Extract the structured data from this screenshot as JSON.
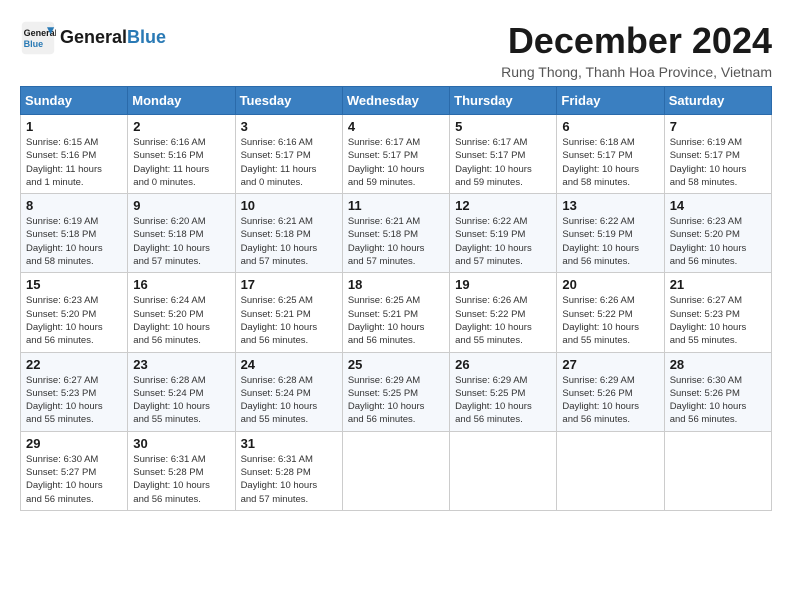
{
  "logo": {
    "line1": "General",
    "line2": "Blue"
  },
  "title": "December 2024",
  "location": "Rung Thong, Thanh Hoa Province, Vietnam",
  "weekdays": [
    "Sunday",
    "Monday",
    "Tuesday",
    "Wednesday",
    "Thursday",
    "Friday",
    "Saturday"
  ],
  "weeks": [
    [
      {
        "day": "1",
        "info": "Sunrise: 6:15 AM\nSunset: 5:16 PM\nDaylight: 11 hours\nand 1 minute."
      },
      {
        "day": "2",
        "info": "Sunrise: 6:16 AM\nSunset: 5:16 PM\nDaylight: 11 hours\nand 0 minutes."
      },
      {
        "day": "3",
        "info": "Sunrise: 6:16 AM\nSunset: 5:17 PM\nDaylight: 11 hours\nand 0 minutes."
      },
      {
        "day": "4",
        "info": "Sunrise: 6:17 AM\nSunset: 5:17 PM\nDaylight: 10 hours\nand 59 minutes."
      },
      {
        "day": "5",
        "info": "Sunrise: 6:17 AM\nSunset: 5:17 PM\nDaylight: 10 hours\nand 59 minutes."
      },
      {
        "day": "6",
        "info": "Sunrise: 6:18 AM\nSunset: 5:17 PM\nDaylight: 10 hours\nand 58 minutes."
      },
      {
        "day": "7",
        "info": "Sunrise: 6:19 AM\nSunset: 5:17 PM\nDaylight: 10 hours\nand 58 minutes."
      }
    ],
    [
      {
        "day": "8",
        "info": "Sunrise: 6:19 AM\nSunset: 5:18 PM\nDaylight: 10 hours\nand 58 minutes."
      },
      {
        "day": "9",
        "info": "Sunrise: 6:20 AM\nSunset: 5:18 PM\nDaylight: 10 hours\nand 57 minutes."
      },
      {
        "day": "10",
        "info": "Sunrise: 6:21 AM\nSunset: 5:18 PM\nDaylight: 10 hours\nand 57 minutes."
      },
      {
        "day": "11",
        "info": "Sunrise: 6:21 AM\nSunset: 5:18 PM\nDaylight: 10 hours\nand 57 minutes."
      },
      {
        "day": "12",
        "info": "Sunrise: 6:22 AM\nSunset: 5:19 PM\nDaylight: 10 hours\nand 57 minutes."
      },
      {
        "day": "13",
        "info": "Sunrise: 6:22 AM\nSunset: 5:19 PM\nDaylight: 10 hours\nand 56 minutes."
      },
      {
        "day": "14",
        "info": "Sunrise: 6:23 AM\nSunset: 5:20 PM\nDaylight: 10 hours\nand 56 minutes."
      }
    ],
    [
      {
        "day": "15",
        "info": "Sunrise: 6:23 AM\nSunset: 5:20 PM\nDaylight: 10 hours\nand 56 minutes."
      },
      {
        "day": "16",
        "info": "Sunrise: 6:24 AM\nSunset: 5:20 PM\nDaylight: 10 hours\nand 56 minutes."
      },
      {
        "day": "17",
        "info": "Sunrise: 6:25 AM\nSunset: 5:21 PM\nDaylight: 10 hours\nand 56 minutes."
      },
      {
        "day": "18",
        "info": "Sunrise: 6:25 AM\nSunset: 5:21 PM\nDaylight: 10 hours\nand 56 minutes."
      },
      {
        "day": "19",
        "info": "Sunrise: 6:26 AM\nSunset: 5:22 PM\nDaylight: 10 hours\nand 55 minutes."
      },
      {
        "day": "20",
        "info": "Sunrise: 6:26 AM\nSunset: 5:22 PM\nDaylight: 10 hours\nand 55 minutes."
      },
      {
        "day": "21",
        "info": "Sunrise: 6:27 AM\nSunset: 5:23 PM\nDaylight: 10 hours\nand 55 minutes."
      }
    ],
    [
      {
        "day": "22",
        "info": "Sunrise: 6:27 AM\nSunset: 5:23 PM\nDaylight: 10 hours\nand 55 minutes."
      },
      {
        "day": "23",
        "info": "Sunrise: 6:28 AM\nSunset: 5:24 PM\nDaylight: 10 hours\nand 55 minutes."
      },
      {
        "day": "24",
        "info": "Sunrise: 6:28 AM\nSunset: 5:24 PM\nDaylight: 10 hours\nand 55 minutes."
      },
      {
        "day": "25",
        "info": "Sunrise: 6:29 AM\nSunset: 5:25 PM\nDaylight: 10 hours\nand 56 minutes."
      },
      {
        "day": "26",
        "info": "Sunrise: 6:29 AM\nSunset: 5:25 PM\nDaylight: 10 hours\nand 56 minutes."
      },
      {
        "day": "27",
        "info": "Sunrise: 6:29 AM\nSunset: 5:26 PM\nDaylight: 10 hours\nand 56 minutes."
      },
      {
        "day": "28",
        "info": "Sunrise: 6:30 AM\nSunset: 5:26 PM\nDaylight: 10 hours\nand 56 minutes."
      }
    ],
    [
      {
        "day": "29",
        "info": "Sunrise: 6:30 AM\nSunset: 5:27 PM\nDaylight: 10 hours\nand 56 minutes."
      },
      {
        "day": "30",
        "info": "Sunrise: 6:31 AM\nSunset: 5:28 PM\nDaylight: 10 hours\nand 56 minutes."
      },
      {
        "day": "31",
        "info": "Sunrise: 6:31 AM\nSunset: 5:28 PM\nDaylight: 10 hours\nand 57 minutes."
      },
      {
        "day": "",
        "info": ""
      },
      {
        "day": "",
        "info": ""
      },
      {
        "day": "",
        "info": ""
      },
      {
        "day": "",
        "info": ""
      }
    ]
  ]
}
